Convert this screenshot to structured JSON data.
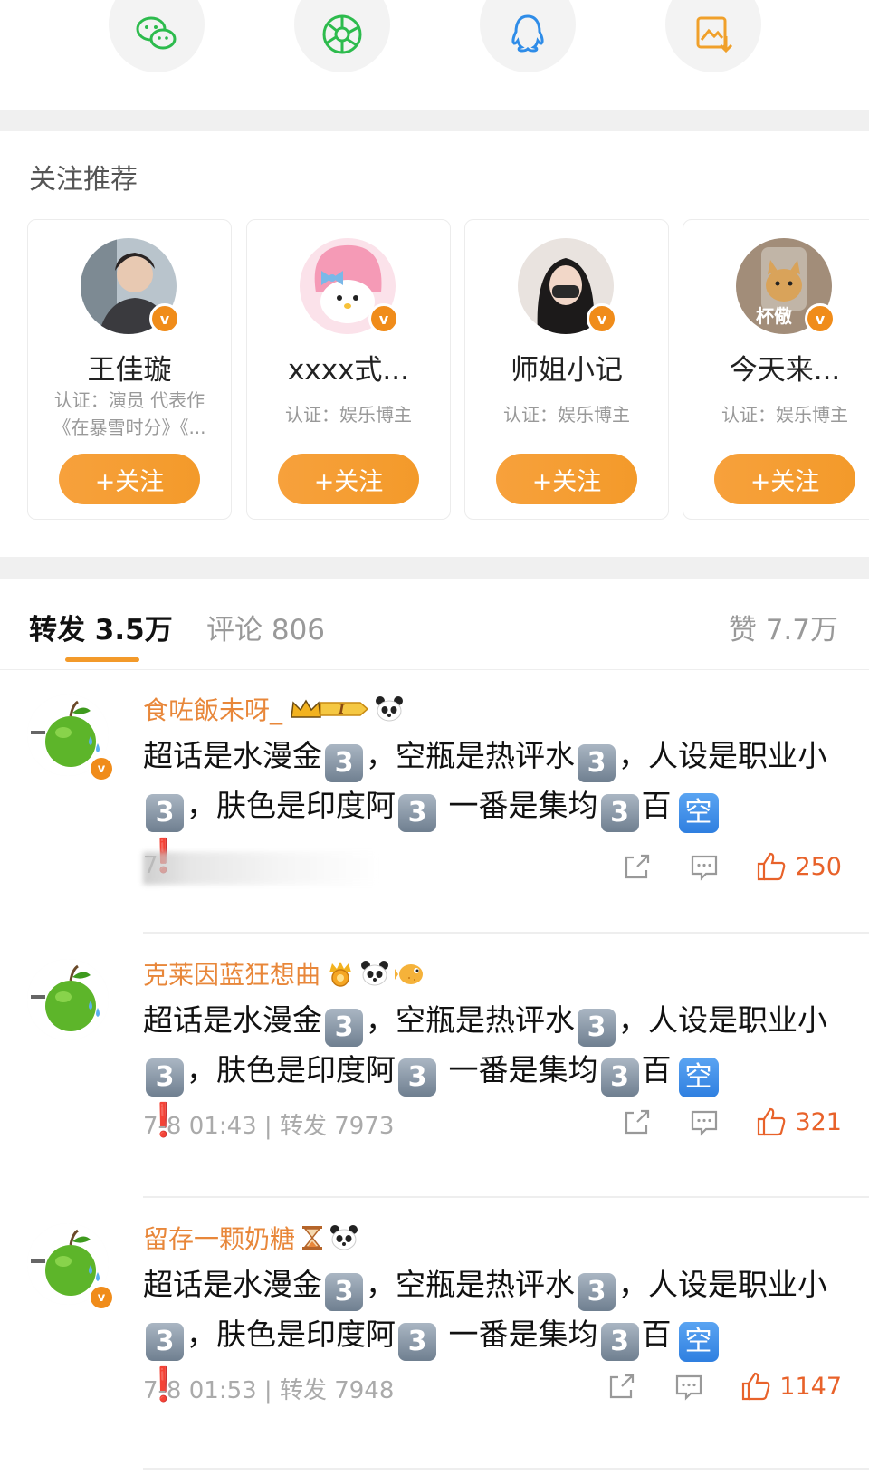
{
  "share": {
    "icons": [
      "wechat-icon",
      "moments-icon",
      "qq-icon",
      "save-image-icon"
    ],
    "colors": [
      "#2dbb4d",
      "#2dbb4d",
      "#2e8ce8",
      "#f0a02a"
    ]
  },
  "recommend": {
    "title": "关注推荐",
    "follow_label": "+关注",
    "cards": [
      {
        "name": "王佳璇",
        "cert_line1": "认证：演员 代表作",
        "cert_line2": "《在暴雪时分》《..."
      },
      {
        "name": "xxxx式...",
        "cert_line1": "认证：娱乐博主",
        "cert_line2": ""
      },
      {
        "name": "师姐小记",
        "cert_line1": "认证：娱乐博主",
        "cert_line2": ""
      },
      {
        "name": "今天来...",
        "cert_line1": "认证：娱乐博主",
        "cert_line2": "",
        "avatar_text": "杯儆"
      }
    ]
  },
  "tabs": {
    "repost": "转发 3.5万",
    "comments": "评论 806",
    "likes": "赞 7.7万"
  },
  "comments": [
    {
      "user": "食咗飯未呀_",
      "level_badge": "I",
      "text_a": "超话是水漫金",
      "text_b": "，空瓶是热评水",
      "text_c": "，人设是职业小",
      "text_d": "，肤色是印度阿",
      "text_e": " 一番是集均",
      "text_f": "百",
      "kong": "空",
      "excl": "❗",
      "meta": "7",
      "likes": "250"
    },
    {
      "user": "克莱因蓝狂想曲",
      "text_a": "超话是水漫金",
      "text_b": "，空瓶是热评水",
      "text_c": "，人设是职业小",
      "text_d": "，肤色是印度阿",
      "text_e": " 一番是集均",
      "text_f": "百",
      "kong": "空",
      "excl": "❗",
      "meta": "7-8 01:43 | 转发 7973",
      "likes": "321"
    },
    {
      "user": "留存一颗奶糖",
      "text_a": "超话是水漫金",
      "text_b": "，空瓶是热评水",
      "text_c": "，人设是职业小",
      "text_d": "，肤色是印度阿",
      "text_e": " 一番是集均",
      "text_f": "百",
      "kong": "空",
      "excl": "❗",
      "meta": "7-8 01:53 | 转发 7948",
      "likes": "1147"
    }
  ],
  "digit": "3",
  "v_badge": "v"
}
